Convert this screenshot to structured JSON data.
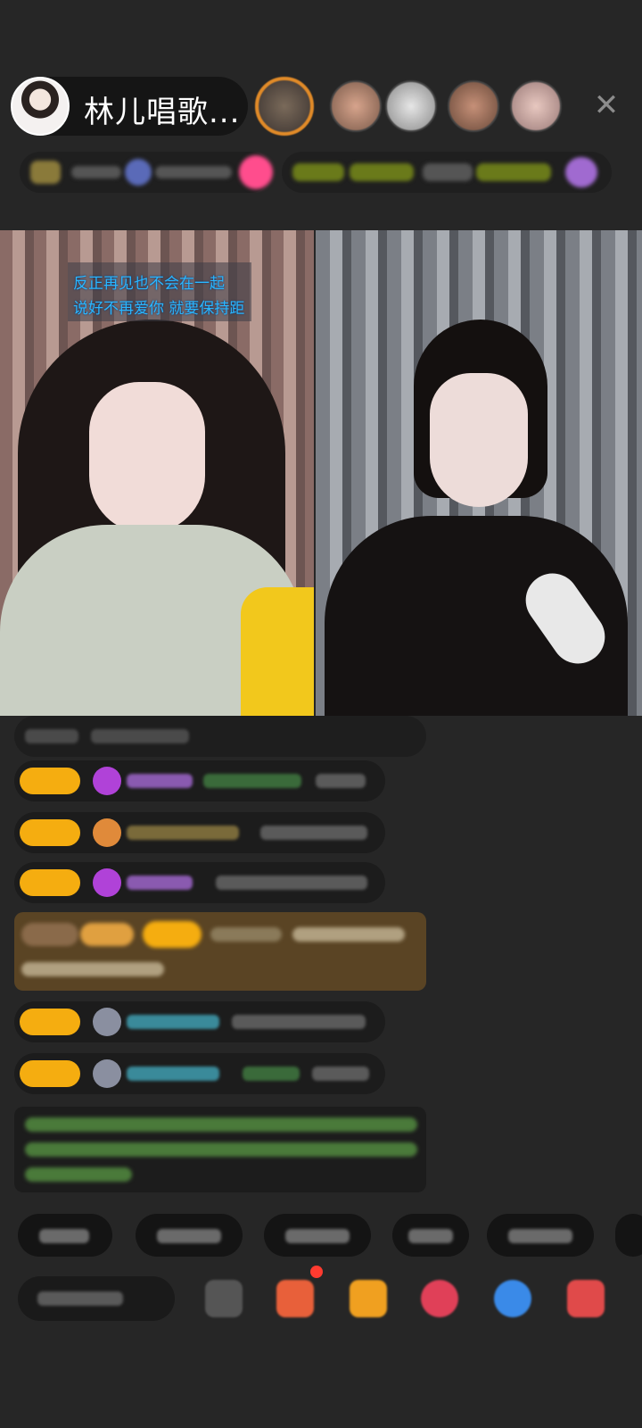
{
  "header": {
    "host_name": "林儿唱歌...",
    "close_label": "✕"
  },
  "video": {
    "lyrics": [
      "反正再见也不会在一起",
      "说好不再爱你 就要保持距"
    ]
  },
  "colors": {
    "badge": "#f5ad10",
    "accent_pink": "#ff4d8d",
    "lyric_blue": "#2ab7ff"
  }
}
